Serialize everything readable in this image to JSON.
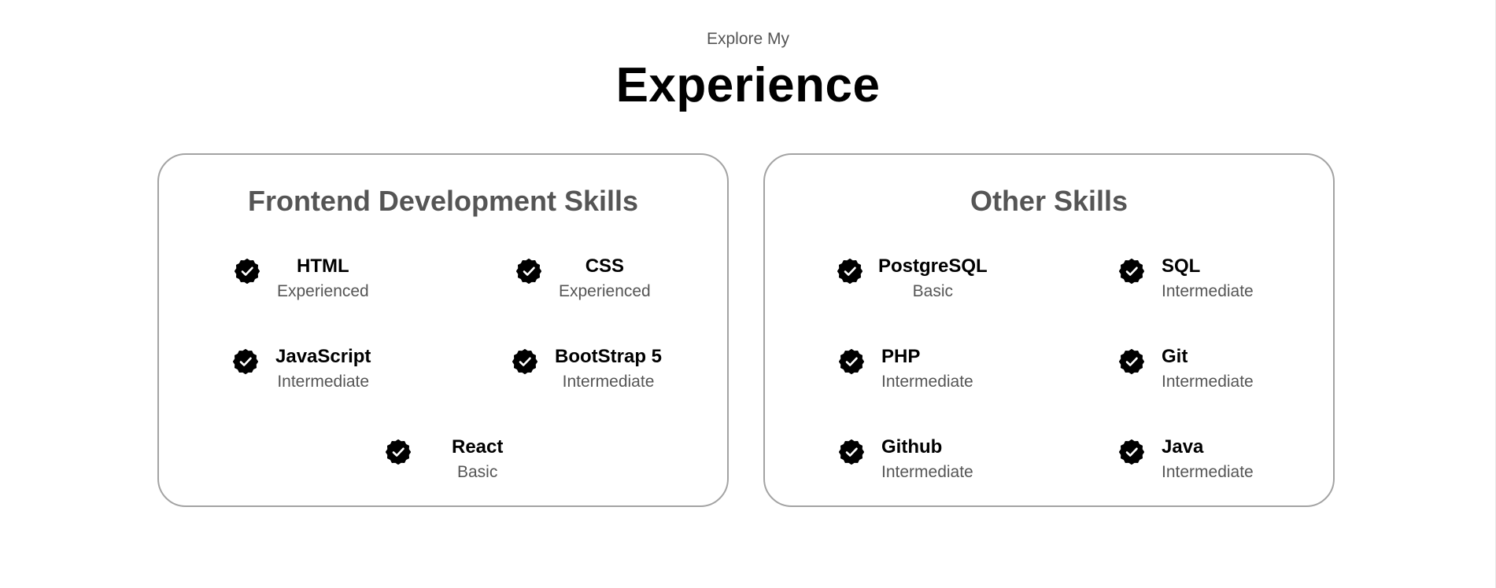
{
  "header": {
    "subtitle": "Explore My",
    "title": "Experience"
  },
  "cards": [
    {
      "title": "Frontend Development Skills",
      "skills": [
        {
          "name": "HTML",
          "level": "Experienced"
        },
        {
          "name": "CSS",
          "level": "Experienced"
        },
        {
          "name": "JavaScript",
          "level": "Intermediate"
        },
        {
          "name": "BootStrap 5",
          "level": "Intermediate"
        },
        {
          "name": "React",
          "level": "Basic"
        }
      ]
    },
    {
      "title": "Other Skills",
      "skills": [
        {
          "name": "PostgreSQL",
          "level": "Basic"
        },
        {
          "name": "SQL",
          "level": "Intermediate"
        },
        {
          "name": "PHP",
          "level": "Intermediate"
        },
        {
          "name": "Git",
          "level": "Intermediate"
        },
        {
          "name": "Github",
          "level": "Intermediate"
        },
        {
          "name": "Java",
          "level": "Intermediate"
        }
      ]
    }
  ],
  "icons": {
    "skill": "verified-check-icon"
  },
  "colors": {
    "card_border": "#a3a3a3",
    "muted_text": "#555555",
    "heading_text": "#000000"
  }
}
